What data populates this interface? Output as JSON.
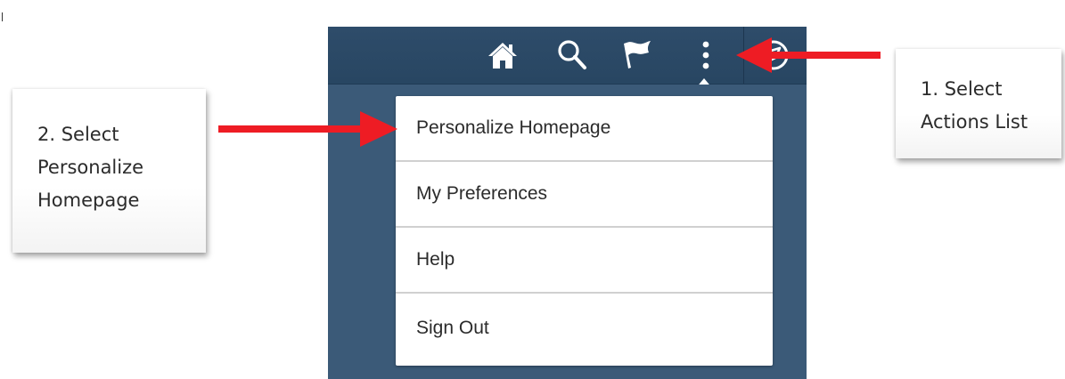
{
  "menu": {
    "items": [
      {
        "label": "Personalize Homepage"
      },
      {
        "label": "My Preferences"
      },
      {
        "label": "Help"
      },
      {
        "label": "Sign Out"
      }
    ]
  },
  "header": {
    "icons": [
      "home-icon",
      "search-icon",
      "flag-icon",
      "actions-list-icon",
      "navbar-icon"
    ]
  },
  "callouts": {
    "step1": {
      "line1": "1. Select",
      "line2": "Actions List"
    },
    "step2": {
      "line1": "2. Select",
      "line2": "Personalize",
      "line3": "Homepage"
    }
  },
  "colors": {
    "header": "#2e4c6a",
    "panel": "#3b5a78",
    "arrow": "#ee1c24",
    "icon": "#ffffff"
  }
}
